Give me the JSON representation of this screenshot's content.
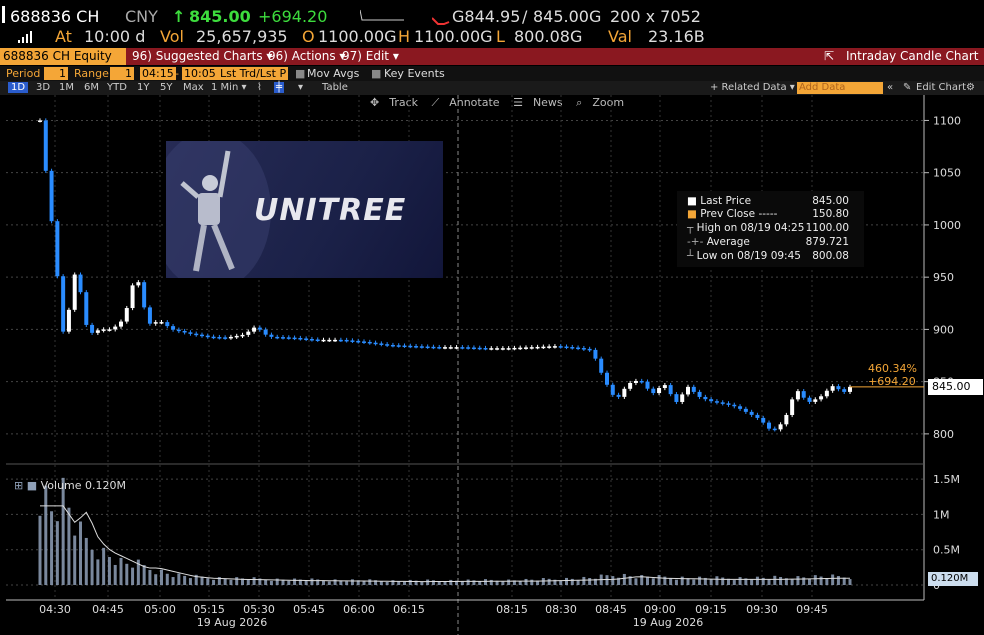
{
  "ticker": {
    "symbol": "688836 CH",
    "currency": "CNY",
    "arrow": "↑",
    "last": "845.00",
    "change": "+694.20",
    "bid": "G844.95",
    "ask": "845.00G",
    "size": "200 x 7052"
  },
  "quote_row": {
    "at_label": "At",
    "time": "10:00 d",
    "vol_label": "Vol",
    "vol": "25,657,935",
    "o_label": "O",
    "open": "1100.00G",
    "h_label": "H",
    "high": "1100.00G",
    "l_label": "L",
    "low": "800.08G",
    "val_label": "Val",
    "val": "23.16B"
  },
  "toolbar": {
    "security": "688836 CH Equity",
    "suggested": "96) Suggested Charts ▾",
    "actions": "96) Actions ▾",
    "edit": "97) Edit ▾",
    "title": "Intraday Candle Chart"
  },
  "period": {
    "period_label": "Period",
    "period_val": "1",
    "range_label": "Range",
    "range_val": "1",
    "start": "04:15",
    "dash": "-",
    "end": "10:05",
    "lst": "Lst Trd/Lst P",
    "mov": "Mov Avgs",
    "key": "Key Events"
  },
  "zoom": {
    "items": [
      "1D",
      "3D",
      "1M",
      "6M",
      "YTD",
      "1Y",
      "5Y",
      "Max",
      "1 Min ▾",
      "Table"
    ],
    "related": "+ Related Data ▾",
    "add": "Add Data",
    "editchart": "Edit Chart"
  },
  "charttools": {
    "track": "Track",
    "annotate": "Annotate",
    "news": "News",
    "zoom": "Zoom"
  },
  "logo_text": "UNITREE",
  "legend": {
    "last_label": "Last Price",
    "last_val": "845.00",
    "prev_label": "Prev Close -----",
    "prev_val": "150.80",
    "high_label": "High on 08/19 04:25",
    "high_val": "1100.00",
    "avg_label": "Average",
    "avg_val": "879.721",
    "low_label": "Low on 08/19 09:45",
    "low_val": "800.08"
  },
  "tags": {
    "pct": "460.34%",
    "chg": "+694.20",
    "price": "845.00",
    "vol": "0.120M",
    "vol_label": "Volume 0.120M"
  },
  "colors": {
    "up": "#ffffff",
    "down": "#2a8cff",
    "accent": "#f4a637",
    "volume": "#8fa0b8"
  },
  "chart_data": {
    "type": "candlestick",
    "ylim": [
      775,
      1110
    ],
    "yticks": [
      "1100",
      "1050",
      "1000",
      "950",
      "900",
      "850",
      "800"
    ],
    "ytick_values": [
      1100,
      1050,
      1000,
      950,
      900,
      850,
      800
    ],
    "vol_ticks": [
      "1.5M",
      "1M",
      "0.5M",
      "0"
    ],
    "vol_tick_values": [
      1.5,
      1.0,
      0.5,
      0
    ],
    "vol_ylim": [
      0,
      1.6
    ],
    "xticks": [
      "04:30",
      "04:45",
      "05:00",
      "05:15",
      "05:30",
      "05:45",
      "06:00",
      "06:15",
      "08:15",
      "08:30",
      "08:45",
      "09:00",
      "09:15",
      "09:30",
      "09:45"
    ],
    "date_labels": [
      "19 Aug 2026",
      "19 Aug 2026"
    ],
    "price_path": [
      [
        0,
        1100
      ],
      [
        2,
        1000
      ],
      [
        4,
        890
      ],
      [
        6,
        960
      ],
      [
        8,
        895
      ],
      [
        10,
        900
      ],
      [
        12,
        900
      ],
      [
        14,
        910
      ],
      [
        16,
        955
      ],
      [
        18,
        905
      ],
      [
        20,
        908
      ],
      [
        22,
        900
      ],
      [
        25,
        896
      ],
      [
        28,
        893
      ],
      [
        31,
        892
      ],
      [
        34,
        895
      ],
      [
        36,
        903
      ],
      [
        38,
        893
      ],
      [
        42,
        892
      ],
      [
        46,
        890
      ],
      [
        50,
        890
      ],
      [
        54,
        888
      ],
      [
        58,
        885
      ],
      [
        62,
        884
      ],
      [
        66,
        883
      ],
      [
        70,
        883
      ],
      [
        74,
        882
      ],
      [
        78,
        882
      ],
      [
        82,
        883
      ],
      [
        86,
        884
      ],
      [
        90,
        882
      ],
      [
        92,
        880
      ],
      [
        94,
        852
      ],
      [
        96,
        832
      ],
      [
        98,
        848
      ],
      [
        100,
        852
      ],
      [
        102,
        838
      ],
      [
        104,
        848
      ],
      [
        106,
        830
      ],
      [
        108,
        845
      ],
      [
        110,
        835
      ],
      [
        112,
        831
      ],
      [
        114,
        829
      ],
      [
        116,
        826
      ],
      [
        118,
        820
      ],
      [
        120,
        814
      ],
      [
        122,
        802
      ],
      [
        124,
        812
      ],
      [
        126,
        843
      ],
      [
        128,
        830
      ],
      [
        130,
        835
      ],
      [
        132,
        846
      ],
      [
        134,
        840
      ],
      [
        135,
        845
      ]
    ],
    "volume_path": [
      [
        0,
        1.4
      ],
      [
        2,
        1.1
      ],
      [
        4,
        1.3
      ],
      [
        6,
        0.8
      ],
      [
        8,
        0.6
      ],
      [
        10,
        0.5
      ],
      [
        12,
        0.4
      ],
      [
        14,
        0.3
      ],
      [
        16,
        0.3
      ],
      [
        18,
        0.25
      ],
      [
        20,
        0.2
      ],
      [
        22,
        0.15
      ],
      [
        25,
        0.12
      ],
      [
        30,
        0.1
      ],
      [
        40,
        0.08
      ],
      [
        60,
        0.06
      ],
      [
        80,
        0.07
      ],
      [
        92,
        0.1
      ],
      [
        96,
        0.15
      ],
      [
        100,
        0.12
      ],
      [
        110,
        0.1
      ],
      [
        120,
        0.1
      ],
      [
        130,
        0.12
      ],
      [
        135,
        0.12
      ]
    ]
  }
}
